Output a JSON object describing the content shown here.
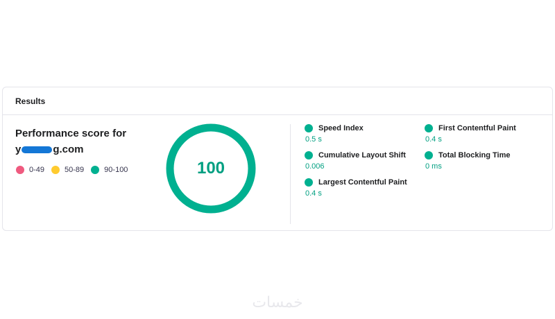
{
  "card": {
    "header": "Results"
  },
  "performance": {
    "title_line1": "Performance score for",
    "domain_prefix": "y",
    "domain_suffix": "g.com",
    "score": "100",
    "score_fraction": 1.0
  },
  "legend": [
    {
      "label": "0-49",
      "color": "#ef5a7f"
    },
    {
      "label": "50-89",
      "color": "#ffcb2f"
    },
    {
      "label": "90-100",
      "color": "#00b090"
    }
  ],
  "metrics": [
    {
      "label": "Speed Index",
      "value": "0.5 s"
    },
    {
      "label": "First Contentful Paint",
      "value": "0.4 s"
    },
    {
      "label": "Cumulative Layout Shift",
      "value": "0.006"
    },
    {
      "label": "Total Blocking Time",
      "value": "0 ms"
    },
    {
      "label": "Largest Contentful Paint",
      "value": "0.4 s"
    }
  ],
  "colors": {
    "good": "#00b090",
    "good_text": "#009f81"
  },
  "watermark": "خمسات"
}
